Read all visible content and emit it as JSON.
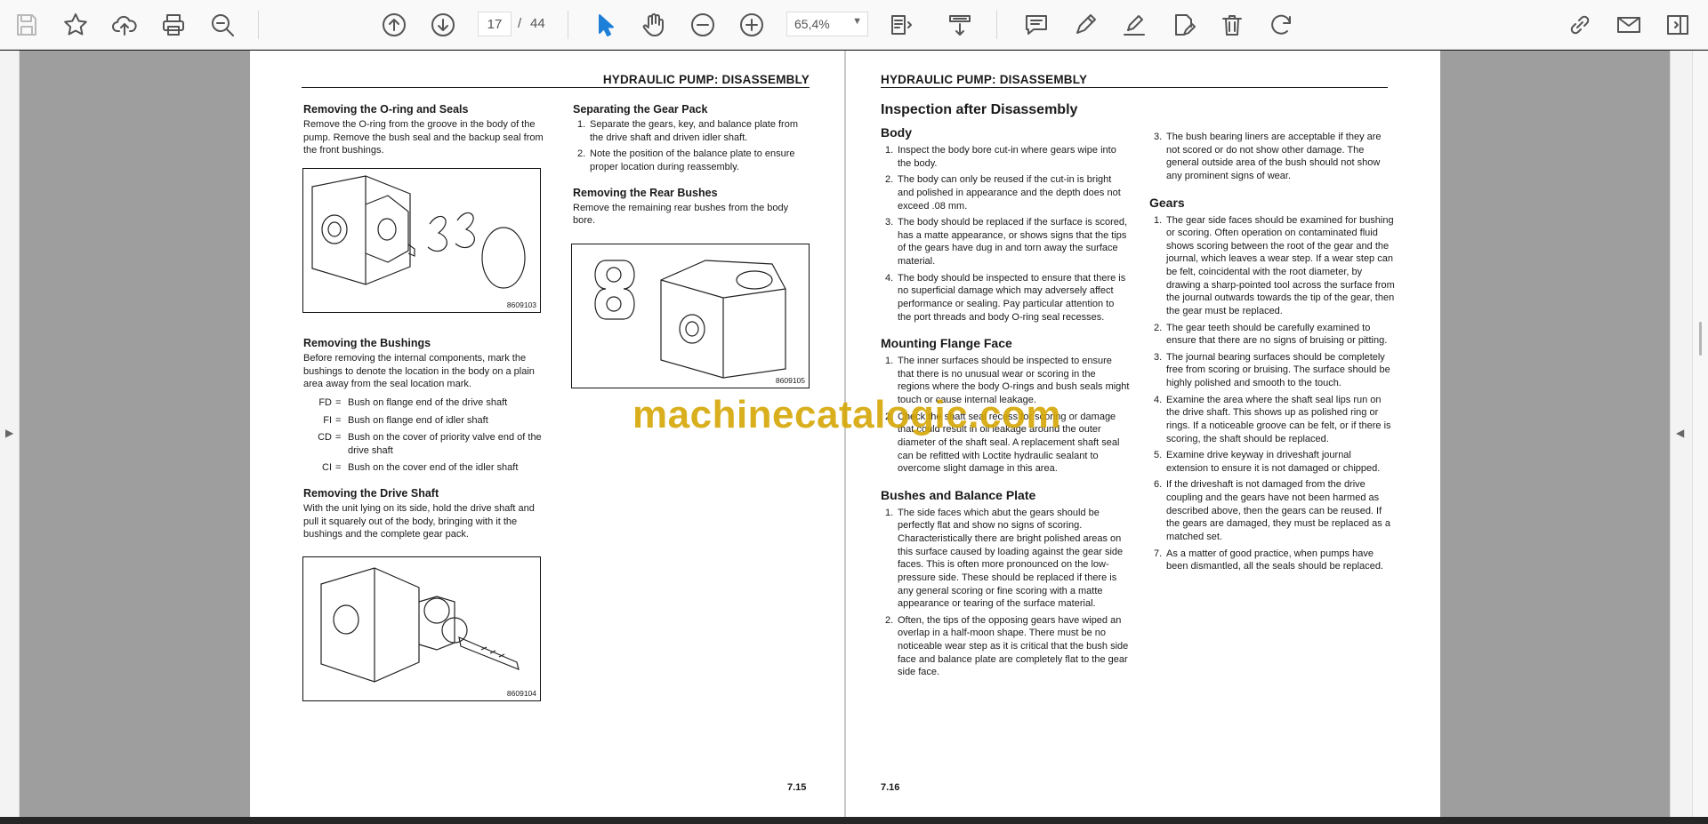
{
  "toolbar": {
    "current_page": "17",
    "page_separator": "/",
    "total_pages": "44",
    "zoom_level": "65,4%"
  },
  "watermark": "machinecatalogic.com",
  "left_page": {
    "header": "HYDRAULIC PUMP: DISASSEMBLY",
    "col1": {
      "s1_title": "Removing the O-ring and Seals",
      "s1_text": "Remove the O-ring from the groove in the body of the pump. Remove the bush seal and the backup seal from the front bushings.",
      "fig1_code": "8609103",
      "s2_title": "Removing the Bushings",
      "s2_text": "Before removing the internal components, mark the bushings to denote the location in the body on a plain area away from the seal location mark.",
      "abbrevs": [
        {
          "k": "FD",
          "v": "Bush on flange end of the drive shaft"
        },
        {
          "k": "FI",
          "v": "Bush on flange end of idler shaft"
        },
        {
          "k": "CD",
          "v": "Bush on the cover of priority valve end of the drive shaft"
        },
        {
          "k": "CI",
          "v": "Bush on the cover end of the idler shaft"
        }
      ],
      "s3_title": "Removing the Drive Shaft",
      "s3_text": "With the unit lying on its side, hold the drive shaft and pull it squarely out of the body, bringing with it the bushings and the complete gear pack.",
      "fig3_code": "8609104"
    },
    "col2": {
      "s4_title": "Separating the Gear Pack",
      "s4_items": [
        "Separate the gears, key, and balance plate from the drive shaft and driven idler shaft.",
        "Note the position of the balance plate to ensure proper location during reassembly."
      ],
      "s5_title": "Removing the Rear Bushes",
      "s5_text": "Remove the remaining rear bushes from the body bore.",
      "fig2_code": "8609105"
    },
    "page_number": "7.15"
  },
  "right_page": {
    "header": "HYDRAULIC PUMP: DISASSEMBLY",
    "title": "Inspection after Disassembly",
    "body_title": "Body",
    "body_items": [
      "Inspect the body bore cut-in where gears wipe into the body.",
      "The body can only be reused if the cut-in is bright and polished in appearance and the depth does not exceed .08 mm.",
      "The body should be replaced if the surface is scored, has a matte appearance, or shows signs that the tips of the gears have dug in and torn away the surface material.",
      "The body should be inspected to ensure that there is no superficial damage which may adversely affect performance or sealing. Pay particular attention to the port threads and body O-ring seal recesses."
    ],
    "flange_title": "Mounting Flange Face",
    "flange_items": [
      "The inner surfaces should be inspected to ensure that there is no unusual wear or scoring in the regions where the body O-rings and bush seals might touch or cause internal leakage.",
      "Check the shaft seal recess for scoring or damage that could result in oil leakage around the outer diameter of the shaft seal. A replacement shaft seal can be refitted with Loctite hydraulic sealant to overcome slight damage in this area."
    ],
    "bushes_title": "Bushes and Balance Plate",
    "bushes_items": [
      "The side faces which abut the gears should be perfectly flat and show no signs of scoring. Characteristically there are bright polished areas on this surface caused by loading against the gear side faces. This is often more pronounced on the low-pressure side. These should be replaced if there is any general scoring or fine scoring with a matte appearance or tearing of the surface material.",
      "Often, the tips of the opposing gears have wiped an overlap in a half-moon shape. There must be no noticeable wear step as it is critical that the bush side face and balance plate are completely flat to the gear side face."
    ],
    "bushes_item3": "The bush bearing liners are acceptable if they are not scored or do not show other damage. The general outside area of the bush should not show any prominent signs of wear.",
    "gears_title": "Gears",
    "gears_items": [
      "The gear side faces should be examined for bushing or scoring. Often operation on contaminated fluid shows scoring between the root of the gear and the journal, which leaves a wear step. If a wear step can be felt, coincidental with the root diameter, by drawing a sharp-pointed tool across the surface from the journal outwards towards the tip of the gear, then the gear must be replaced.",
      "The gear teeth should be carefully examined to ensure that there are no signs of bruising or pitting.",
      "The journal bearing surfaces should be completely free from scoring or bruising. The surface should be highly polished and smooth to the touch.",
      "Examine the area where the shaft seal lips run on the drive shaft. This shows up as polished ring or rings. If a noticeable groove can be felt, or if there is scoring, the shaft should be replaced.",
      "Examine drive keyway in driveshaft journal extension to ensure it is not damaged or chipped.",
      "If the driveshaft is not damaged from the drive coupling and the gears have not been harmed as described above, then the gears can be reused. If the gears are damaged, they must be replaced as a matched set.",
      "As a matter of good practice, when pumps have been dismantled, all the seals should be replaced."
    ],
    "page_number": "7.16"
  }
}
